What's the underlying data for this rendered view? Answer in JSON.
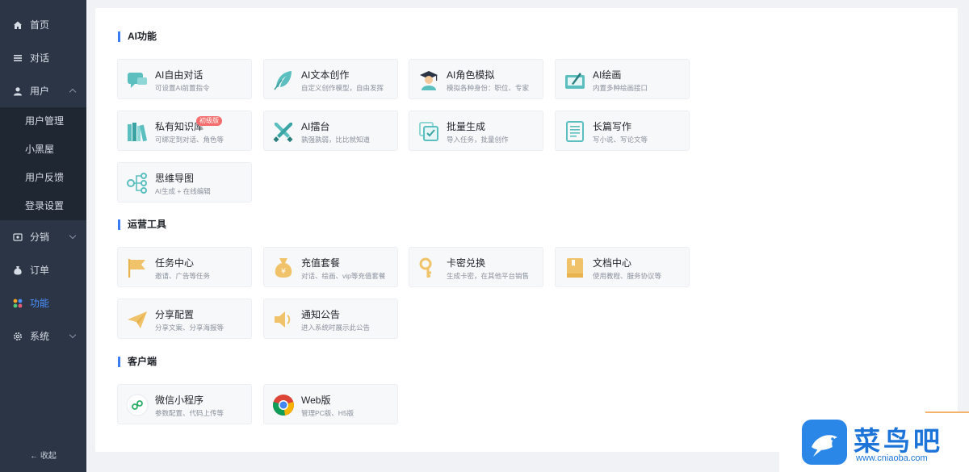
{
  "sidebar": {
    "items": [
      {
        "label": "首页"
      },
      {
        "label": "对话"
      },
      {
        "label": "用户"
      },
      {
        "label": "分销"
      },
      {
        "label": "订单"
      },
      {
        "label": "功能"
      },
      {
        "label": "系统"
      }
    ],
    "submenu": [
      "用户管理",
      "小黑屋",
      "用户反馈",
      "登录设置"
    ],
    "collapse_label": "收起"
  },
  "sections": {
    "ai": "AI功能",
    "ops": "运营工具",
    "client": "客户端"
  },
  "cards": {
    "ai": [
      {
        "title": "AI自由对话",
        "desc": "可设置AI前置指令",
        "icon": "chat-icon"
      },
      {
        "title": "AI文本创作",
        "desc": "自定义创作模型，自由发挥",
        "icon": "feather-icon"
      },
      {
        "title": "AI角色模拟",
        "desc": "模拟各种身份：职位、专家",
        "icon": "graduate-icon"
      },
      {
        "title": "AI绘画",
        "desc": "内置多种绘画接口",
        "icon": "paint-icon"
      },
      {
        "title": "私有知识库",
        "desc": "可绑定到对话、角色等",
        "icon": "books-icon",
        "badge": "初级版"
      },
      {
        "title": "AI擂台",
        "desc": "孰强孰弱，比比就知道",
        "icon": "swords-icon"
      },
      {
        "title": "批量生成",
        "desc": "导入任务，批量创作",
        "icon": "batch-icon"
      },
      {
        "title": "长篇写作",
        "desc": "写小说、写论文等",
        "icon": "document-icon"
      },
      {
        "title": "思维导图",
        "desc": "AI生成 + 在线编辑",
        "icon": "mindmap-icon"
      }
    ],
    "ops": [
      {
        "title": "任务中心",
        "desc": "邀请、广告等任务",
        "icon": "flag-icon"
      },
      {
        "title": "充值套餐",
        "desc": "对话、绘画、vip等充值套餐",
        "icon": "money-bag-icon"
      },
      {
        "title": "卡密兑换",
        "desc": "生成卡密，在其他平台销售",
        "icon": "key-icon"
      },
      {
        "title": "文档中心",
        "desc": "使用教程、服务协议等",
        "icon": "book-icon"
      },
      {
        "title": "分享配置",
        "desc": "分享文案、分享海报等",
        "icon": "paper-plane-icon"
      },
      {
        "title": "通知公告",
        "desc": "进入系统时展示此公告",
        "icon": "speaker-icon"
      }
    ],
    "client": [
      {
        "title": "微信小程序",
        "desc": "参数配置、代码上传等",
        "icon": "miniprogram-icon"
      },
      {
        "title": "Web版",
        "desc": "管理PC版、H5版",
        "icon": "chrome-icon"
      }
    ]
  },
  "watermark": {
    "brand": "菜鸟吧",
    "url": "www.cniaoba.com"
  },
  "colors": {
    "sidebar_bg": "#2b3545",
    "active": "#4a90ff",
    "accent": "#3a7cf5",
    "teal": "#5bbfbf",
    "gold": "#f0c36a"
  }
}
